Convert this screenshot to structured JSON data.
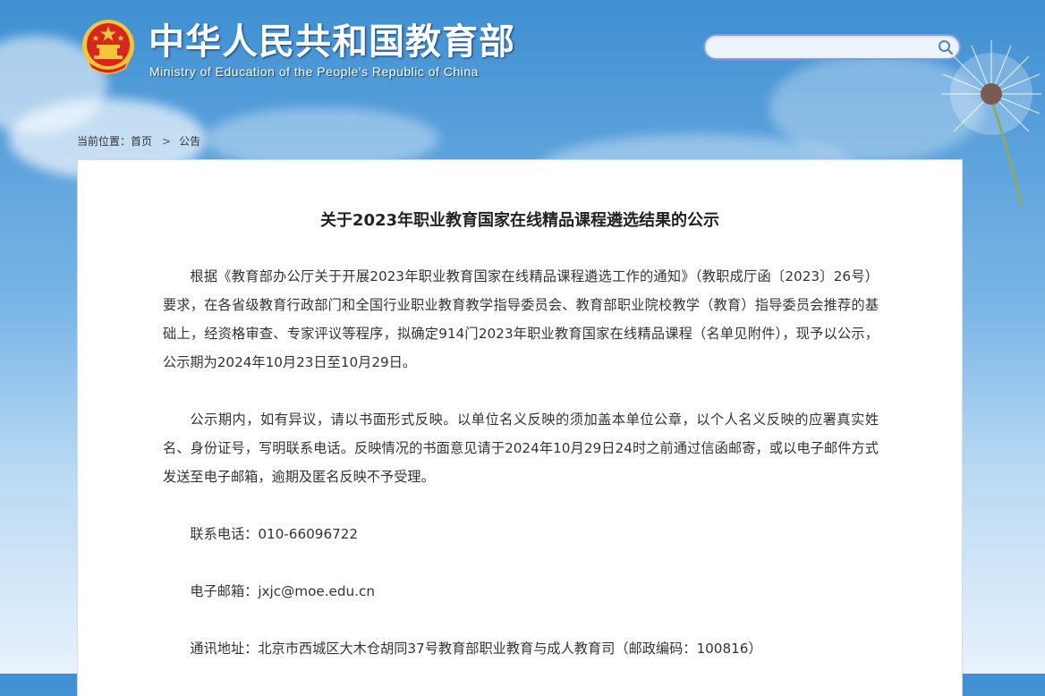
{
  "header": {
    "title_cn": "中华人民共和国教育部",
    "title_en": "Ministry of Education of the People's Republic of China",
    "search": {
      "placeholder": "",
      "value": ""
    }
  },
  "breadcrumb": {
    "prefix": "当前位置：",
    "home": "首页",
    "separator": ">",
    "current": "公告"
  },
  "article": {
    "title": "关于2023年职业教育国家在线精品课程遴选结果的公示",
    "paragraphs": [
      "根据《教育部办公厅关于开展2023年职业教育国家在线精品课程遴选工作的通知》（教职成厅函〔2023〕26号）要求，在各省级教育行政部门和全国行业职业教育教学指导委员会、教育部职业院校教学（教育）指导委员会推荐的基础上，经资格审查、专家评议等程序，拟确定914门2023年职业教育国家在线精品课程（名单见附件），现予以公示，公示期为2024年10月23日至10月29日。",
      "公示期内，如有异议，请以书面形式反映。以单位名义反映的须加盖本单位公章，以个人名义反映的应署真实姓名、身份证号，写明联系电话。反映情况的书面意见请于2024年10月29日24时之前通过信函邮寄，或以电子邮件方式发送至电子邮箱，逾期及匿名反映不予受理。"
    ],
    "contacts": [
      "联系电话：010-66096722",
      "电子邮箱：jxjc@moe.edu.cn",
      "通讯地址：北京市西城区大木仓胡同37号教育部职业教育与成人教育司（邮政编码：100816）"
    ]
  },
  "icons": {
    "emblem": "national-emblem-icon",
    "search": "search-icon",
    "decoration": "dandelion-icon"
  },
  "colors": {
    "sky_top": "#3f8fd2",
    "search_border": "#7a9fe0",
    "emblem_red": "#d7261b",
    "emblem_gold": "#f3c53a"
  }
}
